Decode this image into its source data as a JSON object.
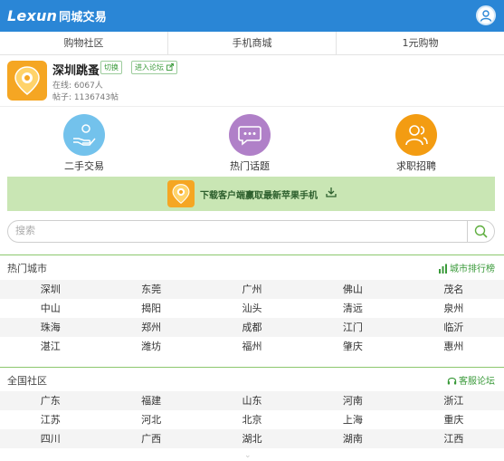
{
  "header": {
    "logo_main": "Lexun",
    "logo_sub": "同城交易"
  },
  "nav": {
    "items": [
      "购物社区",
      "手机商城",
      "1元购物"
    ]
  },
  "forum": {
    "name": "深圳跳蚤",
    "switch_label": "切换",
    "enter_label": "进入论坛",
    "online": "在线: 6067人",
    "posts": "帖子: 1136743帖"
  },
  "quick_links": [
    {
      "label": "二手交易",
      "icon": "hand-money-icon",
      "color": "#73c2ec"
    },
    {
      "label": "热门话题",
      "icon": "chat-bubble-icon",
      "color": "#b080c8"
    },
    {
      "label": "求职招聘",
      "icon": "people-icon",
      "color": "#f39c12"
    }
  ],
  "banner": {
    "text": "下载客户端赢取最新苹果手机",
    "icon": "download-icon"
  },
  "search": {
    "placeholder": "搜索"
  },
  "hot_cities": {
    "title": "热门城市",
    "link": "城市排行榜",
    "rows": [
      [
        "深圳",
        "东莞",
        "广州",
        "佛山",
        "茂名"
      ],
      [
        "中山",
        "揭阳",
        "汕头",
        "清远",
        "泉州"
      ],
      [
        "珠海",
        "郑州",
        "成都",
        "江门",
        "临沂"
      ],
      [
        "湛江",
        "潍坊",
        "福州",
        "肇庆",
        "惠州"
      ]
    ]
  },
  "all_communities": {
    "title": "全国社区",
    "link": "客服论坛",
    "rows": [
      [
        "广东",
        "福建",
        "山东",
        "河南",
        "浙江"
      ],
      [
        "江苏",
        "河北",
        "北京",
        "上海",
        "重庆"
      ],
      [
        "四川",
        "广西",
        "湖北",
        "湖南",
        "江西"
      ]
    ]
  },
  "colors": {
    "brand": "#2a86d6",
    "accent_green": "#3a9a3a",
    "banner_bg": "#c9e6b4"
  }
}
